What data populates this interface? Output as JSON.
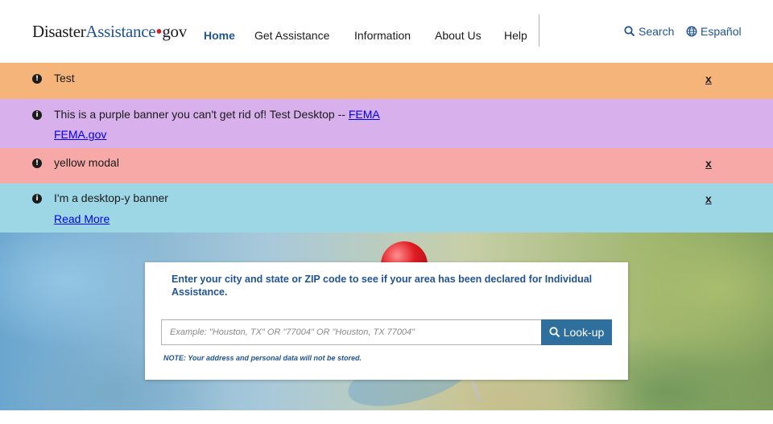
{
  "header": {
    "logo": {
      "part1": "Disaster",
      "part2": "Assistance",
      "part3": "gov"
    },
    "nav": [
      {
        "label": "Home",
        "active": true
      },
      {
        "label": "Get Assistance"
      },
      {
        "label": "Information"
      },
      {
        "label": "About Us"
      },
      {
        "label": "Help"
      }
    ],
    "search_label": "Search",
    "language_label": "Español"
  },
  "banners": [
    {
      "color": "#f5b47a",
      "icon": "exclamation-icon",
      "text": "Test",
      "close_label": "x"
    },
    {
      "color": "#d7b0ec",
      "icon": "info-icon",
      "text": "This is a purple banner you can't get rid of! Test Desktop  -- ",
      "inline_link": "FEMA",
      "link": "FEMA.gov"
    },
    {
      "color": "#f6a9a7",
      "icon": "exclamation-icon",
      "text": "yellow modal",
      "close_label": "x"
    },
    {
      "color": "#9dd7e6",
      "icon": "info-icon",
      "text": "I'm a desktop-y banner",
      "link": "Read More",
      "close_label": "x"
    }
  ],
  "lookup": {
    "prompt": "Enter your city and state or ZIP code to see if your area has been declared for Individual Assistance.",
    "placeholder": "Example: \"Houston, TX\" OR \"77004\" OR \"Houston, TX 77004\"",
    "button_label": "Look-up",
    "note": "NOTE: Your address and personal data will not be stored."
  },
  "colors": {
    "brand_blue": "#205493",
    "button_blue": "#2e6f9e",
    "logo_dot": "#cd2026"
  }
}
